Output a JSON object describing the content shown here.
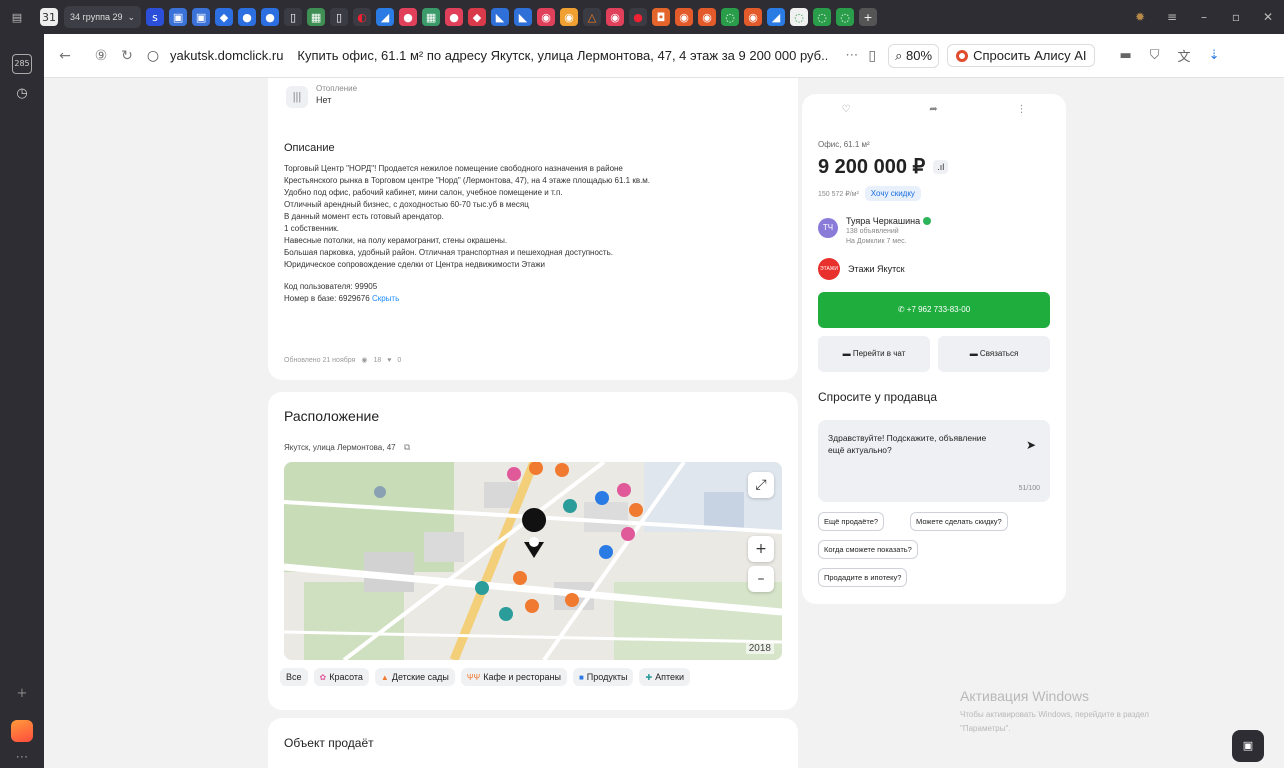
{
  "browser": {
    "tab_group_label": "34 группа 29",
    "domain": "yakutsk.domclick.ru",
    "page_title": "Купить офис, 61.1 м² по адресу Якутск, улица Лермонтова, 47, 4 этаж за 9 200 000 руб...",
    "zoom": "80%",
    "alice_label": "Спросить Алису AI"
  },
  "listing": {
    "heating_label": "Отопление",
    "heating_value": "Нет",
    "description_title": "Описание",
    "description_lines": [
      "Торговый Центр \"НОРД\"! Продается нежилое помещение свободного назначения в районе",
      "Крестьянского рынка в Торговом центре \"Норд\" (Лермонтова, 47), на 4 этаже площадью 61.1 кв.м.",
      "Удобно под офис, рабочий кабинет, мини салон, учебное помещение и т.п.",
      "Отличный арендный бизнес, с доходностью 60-70 тыс.уб в месяц",
      " В данный момент есть готовый арендатор.",
      "1 собственник.",
      "Навесные потолки, на полу керамогранит, стены окрашены.",
      "Большая парковка, удобный район. Отличная транспортная и пешеходная доступность.",
      "Юридическое сопровождение сделки от Центра недвижимости Этажи"
    ],
    "user_code": "Код пользователя: 99905",
    "base_number": "Номер в базе: 6929676",
    "hide_link": "Скрыть",
    "updated": "Обновлено 21 ноября",
    "views": "18",
    "favorites": "0"
  },
  "location": {
    "title": "Расположение",
    "address": "Якутск, улица Лермонтова, 47",
    "map_year": "2018",
    "filters": [
      {
        "label": "Все",
        "icon": ""
      },
      {
        "label": "Красота",
        "icon": "✿"
      },
      {
        "label": "Детские сады",
        "icon": "▲"
      },
      {
        "label": "Кафе и рестораны",
        "icon": "ΨΨ"
      },
      {
        "label": "Продукты",
        "icon": "■"
      },
      {
        "label": "Аптеки",
        "icon": "✚"
      }
    ]
  },
  "seller_section": {
    "title": "Объект продаёт"
  },
  "side": {
    "office_label": "Офис, 61.1 м²",
    "price": "9 200 000 ₽",
    "price_per_m2": "150 572 ₽/м²",
    "discount_button": "Хочу скидку",
    "agent_initials": "ТЧ",
    "agent_name": "Туяра Черкашина",
    "agent_listings": "138 объявлений",
    "agent_since": "На Домклик 7 мес.",
    "agency_logo": "ЭТАЖИ",
    "agency_name": "Этажи Якутск",
    "phone": "+7 962 733-83-00",
    "chat_button": "Перейти в чат",
    "contact_button": "Связаться",
    "ask_title": "Спросите у продавца",
    "message": "Здравствуйте! Подскажите, объявление ещё актуально?",
    "counter": "51/100",
    "quick_questions": [
      "Ещё продаёте?",
      "Можете сделать скидку?",
      "Когда сможете показать?",
      "Продадите в ипотеку?"
    ]
  },
  "watermark": {
    "title": "Активация Windows",
    "subtitle": "Чтобы активировать Windows, перейдите в раздел",
    "subtitle2": "\"Параметры\"."
  },
  "colors": {
    "call_green": "#1fae3e",
    "accent_blue": "#1a8cff",
    "agent_purple": "#8a7bd9",
    "agency_red": "#e8312c"
  }
}
